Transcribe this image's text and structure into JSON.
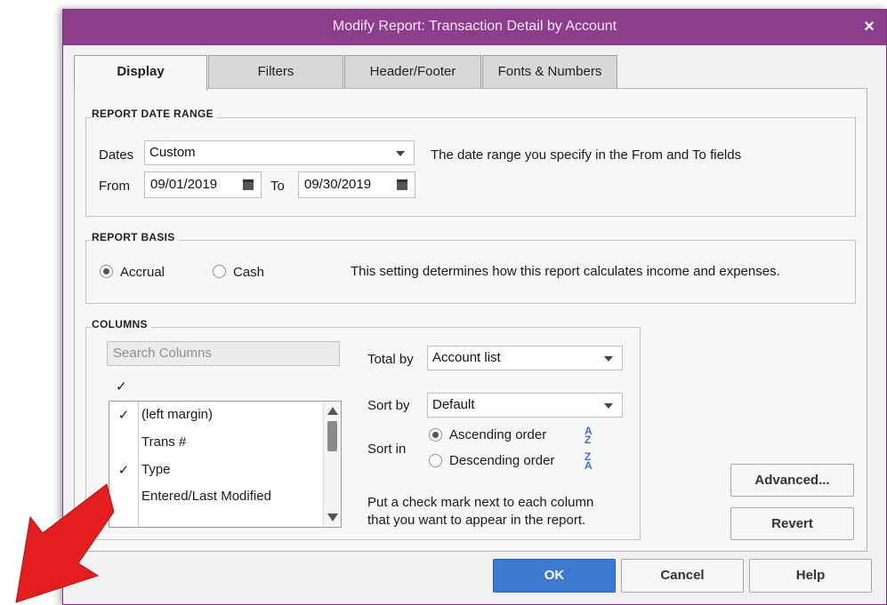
{
  "window": {
    "title": "Modify Report: Transaction Detail by Account",
    "close_glyph": "×"
  },
  "tabs": [
    {
      "label": "Display",
      "active": true
    },
    {
      "label": "Filters",
      "active": false
    },
    {
      "label": "Header/Footer",
      "active": false
    },
    {
      "label": "Fonts & Numbers",
      "active": false
    }
  ],
  "date_range": {
    "heading": "REPORT DATE RANGE",
    "dates_label": "Dates",
    "dates_value": "Custom",
    "description": "The date range you specify in the From and To fields",
    "from_label": "From",
    "from_value": "09/01/2019",
    "to_label": "To",
    "to_value": "09/30/2019",
    "calendar_icon": "calendar-icon"
  },
  "report_basis": {
    "heading": "REPORT BASIS",
    "accrual_label": "Accrual",
    "cash_label": "Cash",
    "selected": "Accrual",
    "description": "This setting determines how this report calculates income and expenses."
  },
  "columns": {
    "heading": "COLUMNS",
    "search_placeholder": "Search Columns",
    "header_check": "✓",
    "items": [
      {
        "checked": true,
        "check": "✓",
        "label": "(left margin)"
      },
      {
        "checked": false,
        "check": "",
        "label": "Trans #"
      },
      {
        "checked": true,
        "check": "✓",
        "label": "Type"
      },
      {
        "checked": false,
        "check": "",
        "label": "Entered/Last Modified"
      }
    ],
    "total_by_label": "Total by",
    "total_by_value": "Account list",
    "sort_by_label": "Sort by",
    "sort_by_value": "Default",
    "sort_in_label": "Sort in",
    "ascending_label": "Ascending order",
    "descending_label": "Descending order",
    "sort_selected": "Ascending order",
    "asc_icon_text": "A Z",
    "desc_icon_text": "Z A",
    "hint_line1": "Put a check mark next to each column",
    "hint_line2": "that you want to appear in the report."
  },
  "side_buttons": {
    "advanced": "Advanced...",
    "revert": "Revert"
  },
  "footer_buttons": {
    "ok": "OK",
    "cancel": "Cancel",
    "help": "Help"
  },
  "colors": {
    "titlebar": "#8c3d8b",
    "ok_button": "#3c79cf",
    "arrow": "#e41e1e"
  }
}
